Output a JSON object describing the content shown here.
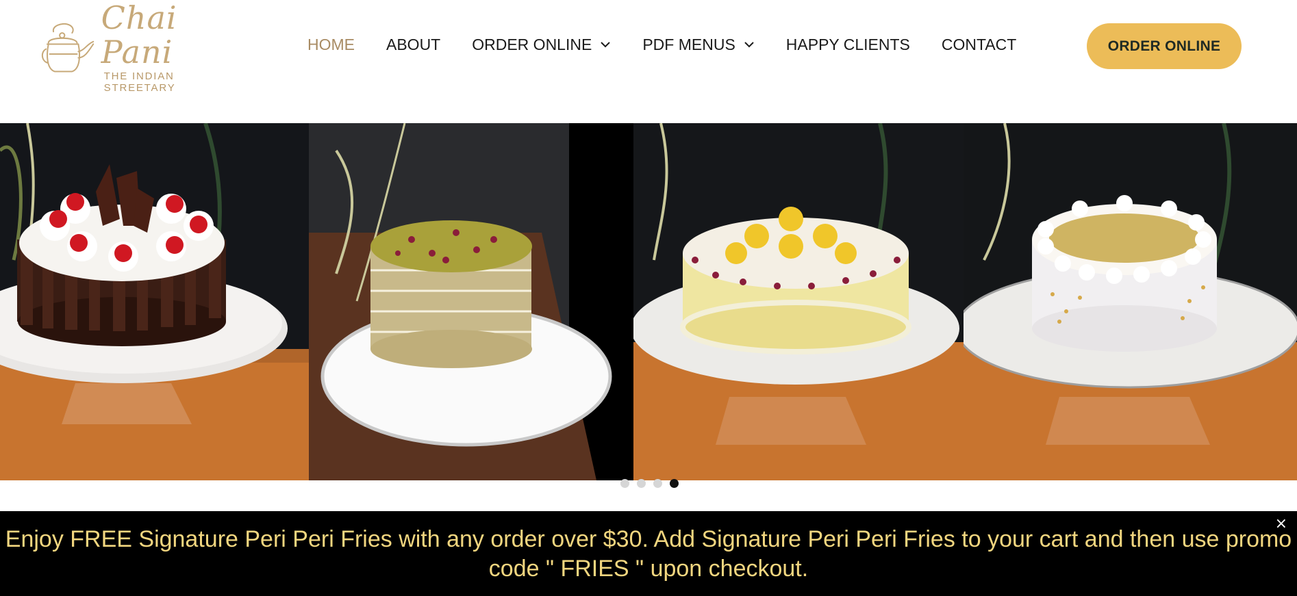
{
  "brand": {
    "name": "Chai Pani",
    "tagline": "THE INDIAN STREETARY",
    "color": "#c7a979"
  },
  "nav": {
    "items": [
      {
        "label": "HOME",
        "active": true
      },
      {
        "label": "ABOUT"
      },
      {
        "label": "ORDER ONLINE",
        "dropdown": true
      },
      {
        "label": "PDF MENUS",
        "dropdown": true
      },
      {
        "label": "HAPPY CLIENTS"
      },
      {
        "label": "CONTACT"
      }
    ]
  },
  "header": {
    "cta_label": "ORDER ONLINE",
    "cta_color": "#ecbc58"
  },
  "gallery": {
    "slides": [
      {
        "subject": "black forest cake with cherries and chocolate curls"
      },
      {
        "subject": "pistachio cake with rose petals"
      },
      {
        "subject": "yellow cake with rasgulla and rose petals"
      },
      {
        "subject": "white cream cake with pistachio topping"
      }
    ],
    "current_slide": 4,
    "total_slides": 4
  },
  "promo": {
    "text": "Enjoy FREE Signature Peri Peri Fries with any order over $30. Add Signature Peri Peri Fries to your cart and then use promo code \" FRIES \" upon checkout.",
    "close_glyph": "×",
    "text_color": "#f2d67f"
  }
}
